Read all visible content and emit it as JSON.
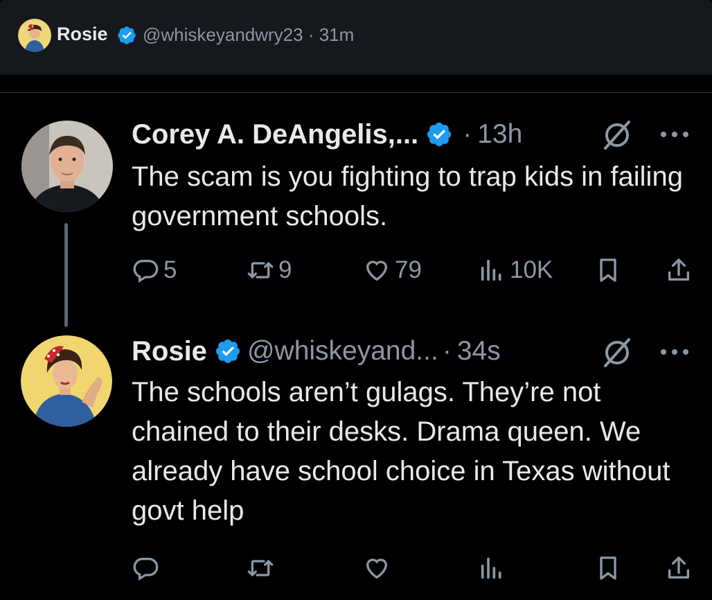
{
  "topbar": {
    "name": "Rosie",
    "meta": "@whiskeyandwry23 · 31m"
  },
  "tweets": [
    {
      "author": "Corey A. DeAngelis,...",
      "time": "13h",
      "dot": "·",
      "text": "The scam is you fighting to trap kids in failing government schools.",
      "replies": "5",
      "retweets": "9",
      "likes": "79",
      "views": "10K"
    },
    {
      "author": "Rosie",
      "handle": "@whiskeyand...",
      "time": "34s",
      "dot": "·",
      "text": "The schools aren’t gulags. They’re not chained to their desks. Drama queen. We already have school choice in Texas without govt help"
    }
  ],
  "colors": {
    "background": "#000000",
    "topbar": "#15181c",
    "text": "#e7e9ea",
    "muted": "#8b98a5",
    "verified": "#1d9bf0"
  },
  "icons": [
    "verified-badge-icon",
    "grok-icon",
    "more-icon",
    "reply-icon",
    "retweet-icon",
    "like-icon",
    "views-icon",
    "bookmark-icon",
    "share-icon"
  ]
}
